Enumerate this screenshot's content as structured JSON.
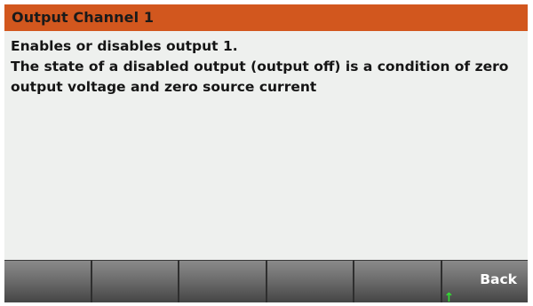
{
  "header": {
    "title": "Output Channel 1"
  },
  "help": {
    "lines": [
      "Enables or disables output 1.",
      "The state of a disabled output (output off) is a condition of zero",
      "output voltage and zero source current"
    ]
  },
  "softkeys": {
    "keys": [
      "",
      "",
      "",
      "",
      "",
      "Back"
    ],
    "back_icon": "arrow-up-icon"
  },
  "colors": {
    "title_bar": "#d2571e",
    "background": "#eef0ee",
    "softkey_text": "#ffffff",
    "back_arrow": "#33dd33"
  }
}
